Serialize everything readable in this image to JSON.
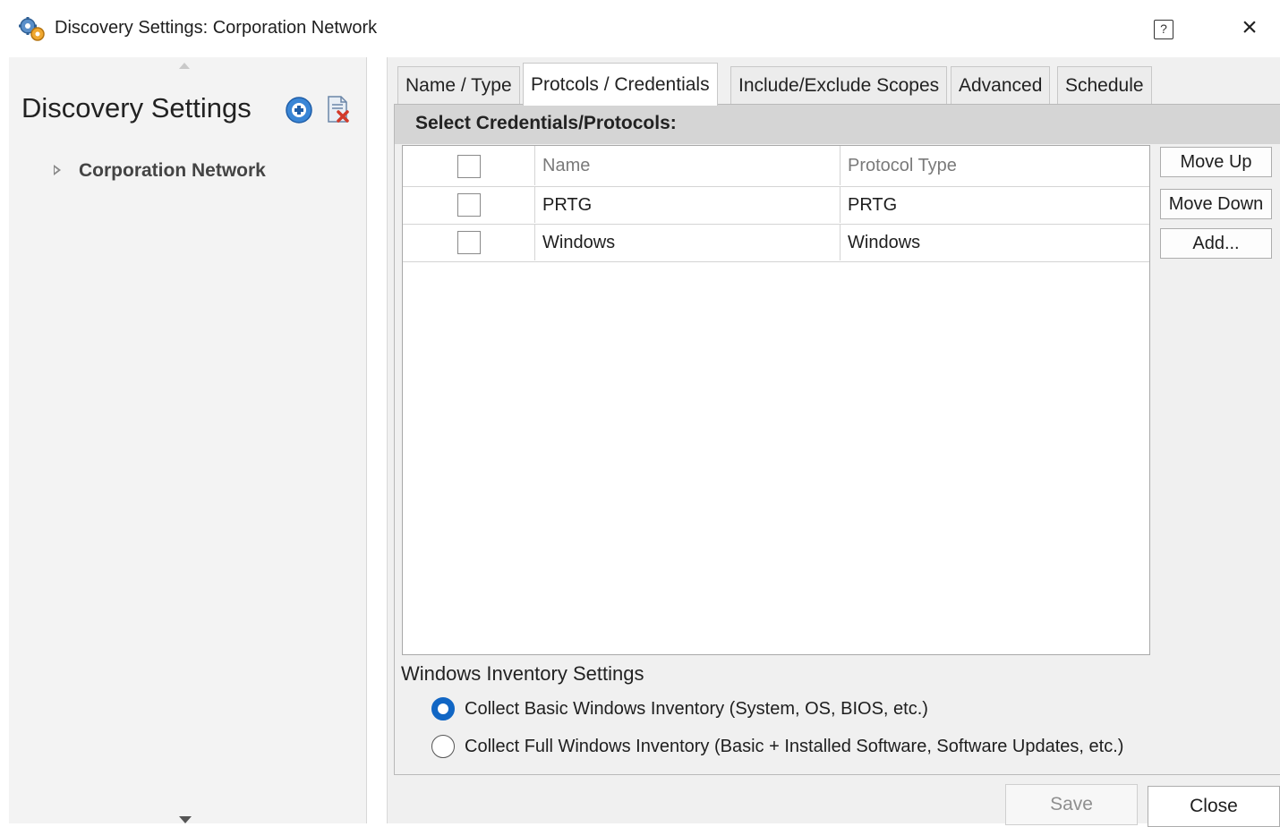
{
  "window": {
    "title": "Discovery Settings: Corporation Network",
    "help_label": "?",
    "close_label": "×"
  },
  "sidebar": {
    "heading": "Discovery Settings",
    "tree": [
      {
        "label": "Corporation Network",
        "expanded": false
      }
    ],
    "icons": {
      "add": "add-circle-icon",
      "delete": "delete-document-icon"
    }
  },
  "tabs": [
    {
      "label": "Name / Type",
      "active": false
    },
    {
      "label": "Protcols / Credentials",
      "active": true
    },
    {
      "label": "Include/Exclude Scopes",
      "active": false
    },
    {
      "label": "Advanced",
      "active": false
    },
    {
      "label": "Schedule",
      "active": false
    }
  ],
  "credentials": {
    "group_title": "Select Credentials/Protocols:",
    "columns": [
      "Name",
      "Protocol Type"
    ],
    "rows": [
      {
        "checked": false,
        "name": "PRTG",
        "protocol": "PRTG"
      },
      {
        "checked": false,
        "name": "Windows",
        "protocol": "Windows"
      }
    ],
    "buttons": {
      "move_up": "Move Up",
      "move_down": "Move Down",
      "add": "Add..."
    }
  },
  "inventory": {
    "heading": "Windows Inventory Settings",
    "options": [
      {
        "label": "Collect Basic Windows Inventory (System, OS, BIOS, etc.)",
        "selected": true
      },
      {
        "label": "Collect Full Windows Inventory (Basic + Installed Software, Software Updates, etc.)",
        "selected": false
      }
    ]
  },
  "footer": {
    "save_label": "Save",
    "close_label": "Close"
  },
  "colors": {
    "radio_selected": "#1166c4",
    "group_header_bg": "#d5d5d5",
    "panel_bg": "#f0f0f0"
  }
}
